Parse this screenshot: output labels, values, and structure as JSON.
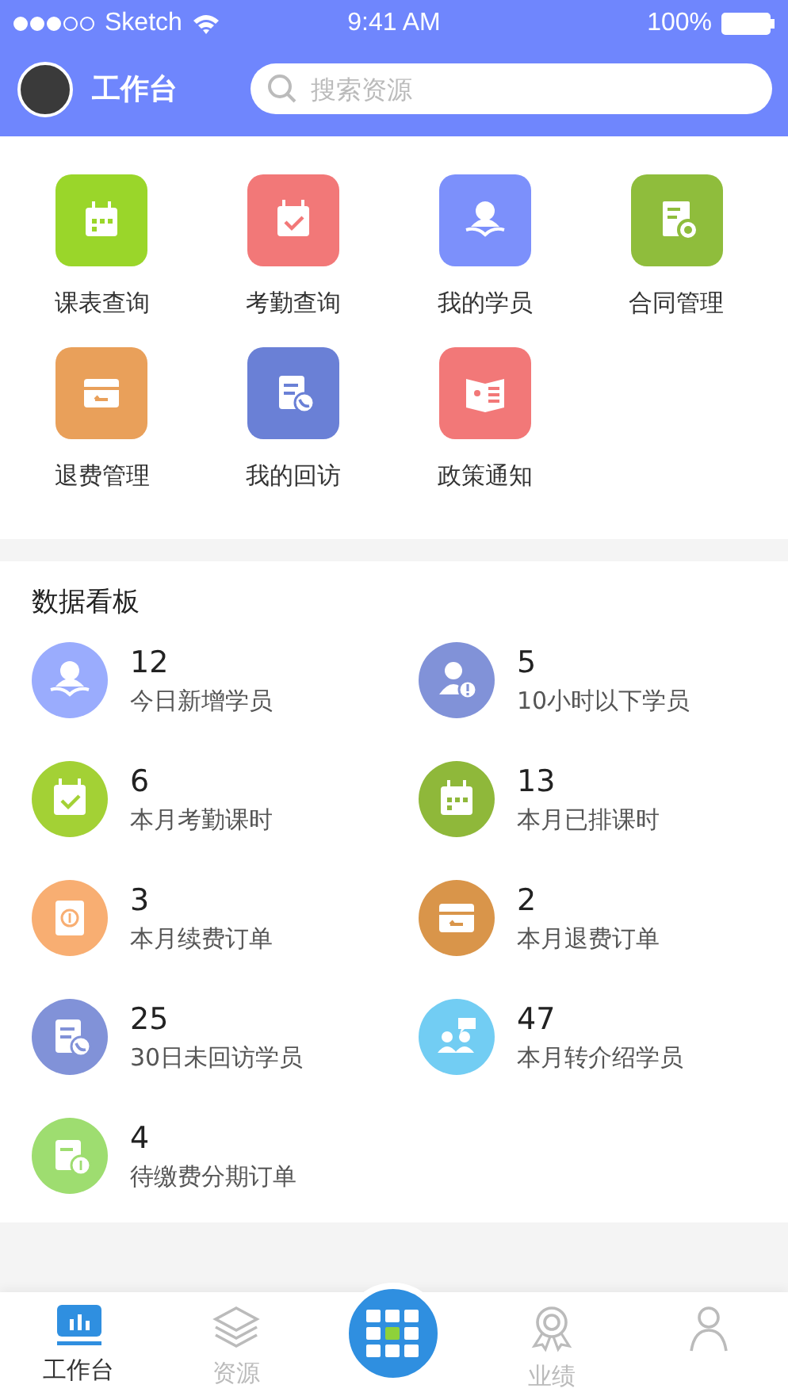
{
  "status_bar": {
    "carrier": "Sketch",
    "time": "9:41 AM",
    "battery": "100%"
  },
  "header": {
    "title": "工作台",
    "search": {
      "placeholder": "搜索资源"
    }
  },
  "shortcuts": [
    {
      "label": "课表查询",
      "kind": "calendar",
      "color": "#9ad62a"
    },
    {
      "label": "考勤查询",
      "kind": "check",
      "color": "#f27878"
    },
    {
      "label": "我的学员",
      "kind": "student",
      "color": "#7c90fb"
    },
    {
      "label": "合同管理",
      "kind": "contract",
      "color": "#8fbd3c"
    },
    {
      "label": "退费管理",
      "kind": "refund",
      "color": "#e9a05a"
    },
    {
      "label": "我的回访",
      "kind": "call",
      "color": "#6a80d6"
    },
    {
      "label": "政策通知",
      "kind": "notice",
      "color": "#f27878"
    }
  ],
  "board": {
    "title": "数据看板",
    "stats": [
      {
        "value": "12",
        "label": "今日新增学员",
        "kind": "student",
        "color": "#9aacfd"
      },
      {
        "value": "5",
        "label": "10小时以下学员",
        "kind": "alert",
        "color": "#8192d8"
      },
      {
        "value": "6",
        "label": "本月考勤课时",
        "kind": "check",
        "color": "#a3d135"
      },
      {
        "value": "13",
        "label": "本月已排课时",
        "kind": "calendar",
        "color": "#8fb83a"
      },
      {
        "value": "3",
        "label": "本月续费订单",
        "kind": "renew",
        "color": "#f8ae72"
      },
      {
        "value": "2",
        "label": "本月退费订单",
        "kind": "refund",
        "color": "#d9954a"
      },
      {
        "value": "25",
        "label": "30日未回访学员",
        "kind": "call",
        "color": "#8192d8"
      },
      {
        "value": "47",
        "label": "本月转介绍学员",
        "kind": "referral",
        "color": "#72cdf3"
      },
      {
        "value": "4",
        "label": "待缴费分期订单",
        "kind": "installment",
        "color": "#9edd70"
      }
    ]
  },
  "tab_bar": [
    {
      "label": "工作台",
      "kind": "chart",
      "selected": true
    },
    {
      "label": "资源",
      "kind": "layers",
      "selected": false
    },
    {
      "kind": "center",
      "selected": false
    },
    {
      "label": "业绩",
      "kind": "award",
      "selected": false
    },
    {
      "kind": "person",
      "selected": false
    }
  ]
}
